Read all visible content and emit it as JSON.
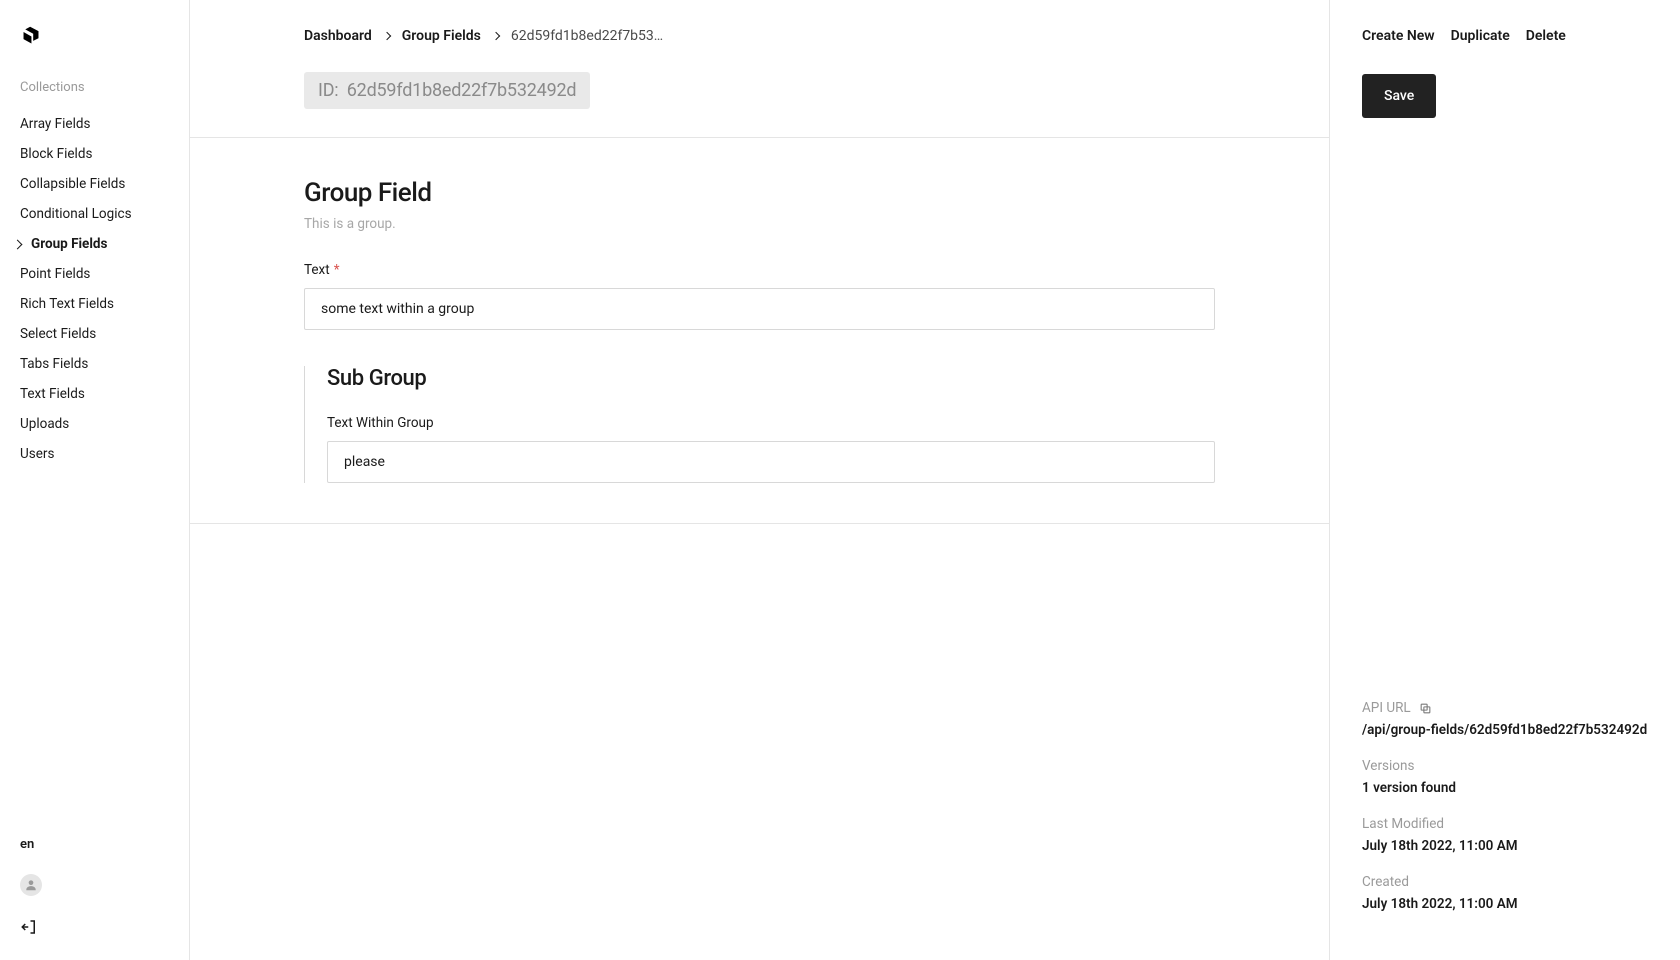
{
  "sidebar": {
    "section_label": "Collections",
    "items": [
      {
        "label": "Array Fields"
      },
      {
        "label": "Block Fields"
      },
      {
        "label": "Collapsible Fields"
      },
      {
        "label": "Conditional Logics"
      },
      {
        "label": "Group Fields",
        "active": true
      },
      {
        "label": "Point Fields"
      },
      {
        "label": "Rich Text Fields"
      },
      {
        "label": "Select Fields"
      },
      {
        "label": "Tabs Fields"
      },
      {
        "label": "Text Fields"
      },
      {
        "label": "Uploads"
      },
      {
        "label": "Users"
      }
    ],
    "locale": "en"
  },
  "breadcrumb": {
    "items": [
      {
        "label": "Dashboard"
      },
      {
        "label": "Group Fields"
      },
      {
        "label": "62d59fd1b8ed22f7b53…",
        "current": true
      }
    ]
  },
  "doc": {
    "id_label": "ID:",
    "id_value": "62d59fd1b8ed22f7b532492d"
  },
  "form": {
    "group_title": "Group Field",
    "group_desc": "This is a group.",
    "text_field": {
      "label": "Text",
      "required": "*",
      "value": "some text within a group"
    },
    "subgroup": {
      "title": "Sub Group",
      "text_field": {
        "label": "Text Within Group",
        "value": "please"
      }
    }
  },
  "rail": {
    "actions": {
      "create": "Create New",
      "duplicate": "Duplicate",
      "delete": "Delete"
    },
    "save_label": "Save",
    "meta": {
      "api_url_label": "API URL",
      "api_url_value": "/api/group-fields/62d59fd1b8ed22f7b532492d",
      "versions_label": "Versions",
      "versions_value": "1 version found",
      "last_modified_label": "Last Modified",
      "last_modified_value": "July 18th 2022, 11:00 AM",
      "created_label": "Created",
      "created_value": "July 18th 2022, 11:00 AM"
    }
  }
}
